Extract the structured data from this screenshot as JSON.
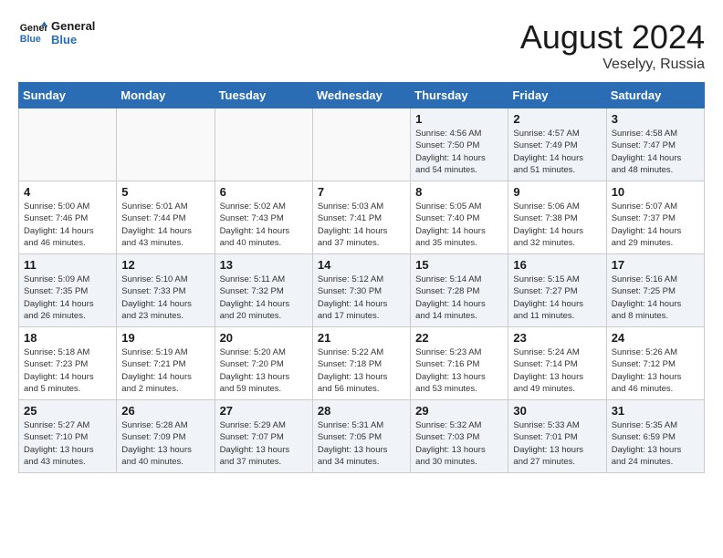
{
  "header": {
    "logo_line1": "General",
    "logo_line2": "Blue",
    "month_year": "August 2024",
    "location": "Veselyy, Russia"
  },
  "weekdays": [
    "Sunday",
    "Monday",
    "Tuesday",
    "Wednesday",
    "Thursday",
    "Friday",
    "Saturday"
  ],
  "weeks": [
    [
      {
        "day": "",
        "info": "",
        "empty": true
      },
      {
        "day": "",
        "info": "",
        "empty": true
      },
      {
        "day": "",
        "info": "",
        "empty": true
      },
      {
        "day": "",
        "info": "",
        "empty": true
      },
      {
        "day": "1",
        "info": "Sunrise: 4:56 AM\nSunset: 7:50 PM\nDaylight: 14 hours\nand 54 minutes."
      },
      {
        "day": "2",
        "info": "Sunrise: 4:57 AM\nSunset: 7:49 PM\nDaylight: 14 hours\nand 51 minutes."
      },
      {
        "day": "3",
        "info": "Sunrise: 4:58 AM\nSunset: 7:47 PM\nDaylight: 14 hours\nand 48 minutes."
      }
    ],
    [
      {
        "day": "4",
        "info": "Sunrise: 5:00 AM\nSunset: 7:46 PM\nDaylight: 14 hours\nand 46 minutes."
      },
      {
        "day": "5",
        "info": "Sunrise: 5:01 AM\nSunset: 7:44 PM\nDaylight: 14 hours\nand 43 minutes."
      },
      {
        "day": "6",
        "info": "Sunrise: 5:02 AM\nSunset: 7:43 PM\nDaylight: 14 hours\nand 40 minutes."
      },
      {
        "day": "7",
        "info": "Sunrise: 5:03 AM\nSunset: 7:41 PM\nDaylight: 14 hours\nand 37 minutes."
      },
      {
        "day": "8",
        "info": "Sunrise: 5:05 AM\nSunset: 7:40 PM\nDaylight: 14 hours\nand 35 minutes."
      },
      {
        "day": "9",
        "info": "Sunrise: 5:06 AM\nSunset: 7:38 PM\nDaylight: 14 hours\nand 32 minutes."
      },
      {
        "day": "10",
        "info": "Sunrise: 5:07 AM\nSunset: 7:37 PM\nDaylight: 14 hours\nand 29 minutes."
      }
    ],
    [
      {
        "day": "11",
        "info": "Sunrise: 5:09 AM\nSunset: 7:35 PM\nDaylight: 14 hours\nand 26 minutes."
      },
      {
        "day": "12",
        "info": "Sunrise: 5:10 AM\nSunset: 7:33 PM\nDaylight: 14 hours\nand 23 minutes."
      },
      {
        "day": "13",
        "info": "Sunrise: 5:11 AM\nSunset: 7:32 PM\nDaylight: 14 hours\nand 20 minutes."
      },
      {
        "day": "14",
        "info": "Sunrise: 5:12 AM\nSunset: 7:30 PM\nDaylight: 14 hours\nand 17 minutes."
      },
      {
        "day": "15",
        "info": "Sunrise: 5:14 AM\nSunset: 7:28 PM\nDaylight: 14 hours\nand 14 minutes."
      },
      {
        "day": "16",
        "info": "Sunrise: 5:15 AM\nSunset: 7:27 PM\nDaylight: 14 hours\nand 11 minutes."
      },
      {
        "day": "17",
        "info": "Sunrise: 5:16 AM\nSunset: 7:25 PM\nDaylight: 14 hours\nand 8 minutes."
      }
    ],
    [
      {
        "day": "18",
        "info": "Sunrise: 5:18 AM\nSunset: 7:23 PM\nDaylight: 14 hours\nand 5 minutes."
      },
      {
        "day": "19",
        "info": "Sunrise: 5:19 AM\nSunset: 7:21 PM\nDaylight: 14 hours\nand 2 minutes."
      },
      {
        "day": "20",
        "info": "Sunrise: 5:20 AM\nSunset: 7:20 PM\nDaylight: 13 hours\nand 59 minutes."
      },
      {
        "day": "21",
        "info": "Sunrise: 5:22 AM\nSunset: 7:18 PM\nDaylight: 13 hours\nand 56 minutes."
      },
      {
        "day": "22",
        "info": "Sunrise: 5:23 AM\nSunset: 7:16 PM\nDaylight: 13 hours\nand 53 minutes."
      },
      {
        "day": "23",
        "info": "Sunrise: 5:24 AM\nSunset: 7:14 PM\nDaylight: 13 hours\nand 49 minutes."
      },
      {
        "day": "24",
        "info": "Sunrise: 5:26 AM\nSunset: 7:12 PM\nDaylight: 13 hours\nand 46 minutes."
      }
    ],
    [
      {
        "day": "25",
        "info": "Sunrise: 5:27 AM\nSunset: 7:10 PM\nDaylight: 13 hours\nand 43 minutes."
      },
      {
        "day": "26",
        "info": "Sunrise: 5:28 AM\nSunset: 7:09 PM\nDaylight: 13 hours\nand 40 minutes."
      },
      {
        "day": "27",
        "info": "Sunrise: 5:29 AM\nSunset: 7:07 PM\nDaylight: 13 hours\nand 37 minutes."
      },
      {
        "day": "28",
        "info": "Sunrise: 5:31 AM\nSunset: 7:05 PM\nDaylight: 13 hours\nand 34 minutes."
      },
      {
        "day": "29",
        "info": "Sunrise: 5:32 AM\nSunset: 7:03 PM\nDaylight: 13 hours\nand 30 minutes."
      },
      {
        "day": "30",
        "info": "Sunrise: 5:33 AM\nSunset: 7:01 PM\nDaylight: 13 hours\nand 27 minutes."
      },
      {
        "day": "31",
        "info": "Sunrise: 5:35 AM\nSunset: 6:59 PM\nDaylight: 13 hours\nand 24 minutes."
      }
    ]
  ]
}
